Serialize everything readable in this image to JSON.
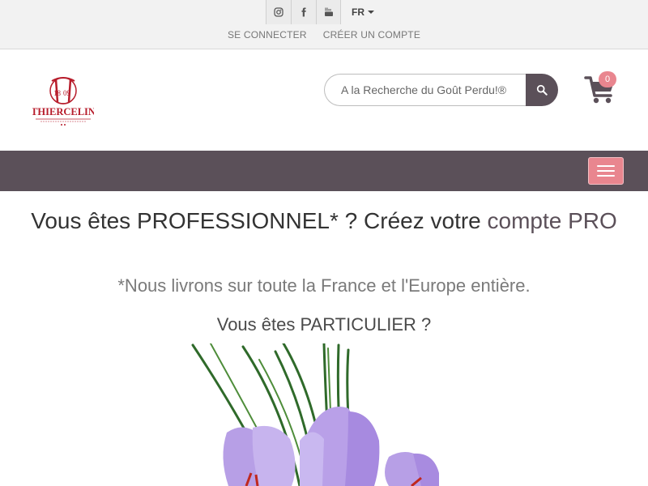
{
  "topbar": {
    "social": [
      {
        "name": "instagram-icon"
      },
      {
        "name": "facebook-icon"
      },
      {
        "name": "youtube-icon"
      }
    ],
    "language": "FR",
    "login_label": "SE CONNECTER",
    "register_label": "CRÉER UN COMPTE"
  },
  "header": {
    "logo_text": "THIERCELIN",
    "logo_year_left": "18",
    "logo_year_right": "09",
    "search_placeholder": "A la Recherche du Goût Perdu!®",
    "cart_count": "0"
  },
  "colors": {
    "accent": "#5b5059",
    "pink": "#e9868f",
    "logo_red": "#b71c2b"
  },
  "content": {
    "headline_part1": "Vous êtes PROFESSIONNEL* ? Créez votre ",
    "headline_link": "compte PRO",
    "delivery_note": "*Nous livrons sur toute la France et l'Europe entière.",
    "particulier": "Vous êtes PARTICULIER ?"
  }
}
